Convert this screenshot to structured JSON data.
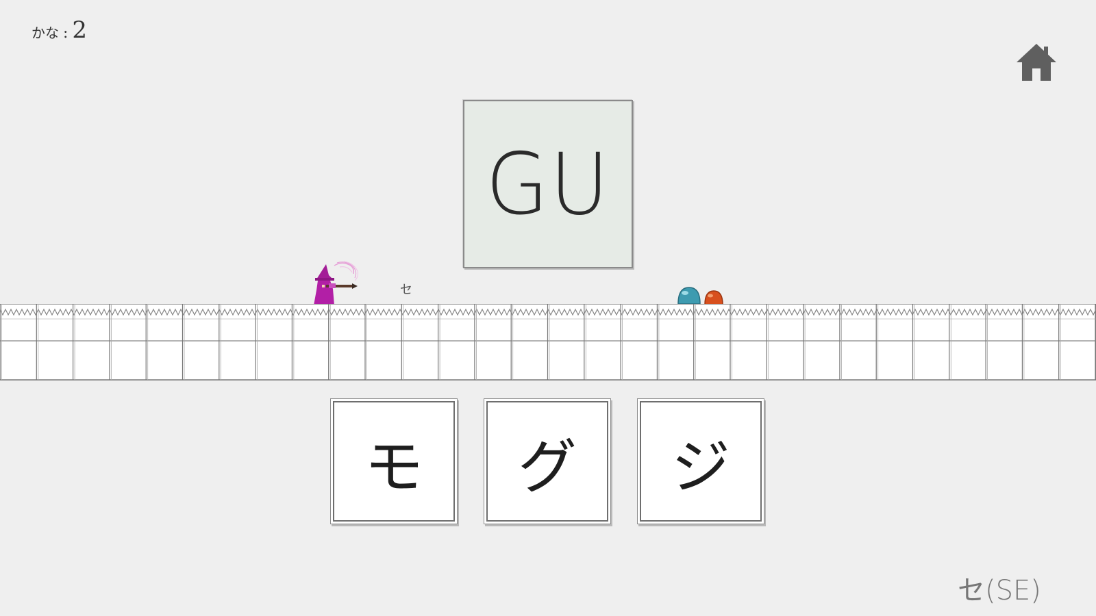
{
  "hud": {
    "kana_label": "かな",
    "kana_separator": ":",
    "kana_count": "2"
  },
  "home_icon": "home-icon",
  "prompt": {
    "romaji": "GU"
  },
  "floating_kana": "セ",
  "choices": [
    {
      "label": "モ"
    },
    {
      "label": "グ"
    },
    {
      "label": "ジ"
    }
  ],
  "hint": "セ(SE)",
  "colors": {
    "background": "#efefef",
    "prompt_card": "#e6ebe6",
    "wizard": "#b21fa6",
    "slime_blue": "#3e9bb0",
    "slime_orange": "#d8501e",
    "home_icon": "#5f5f5f"
  }
}
